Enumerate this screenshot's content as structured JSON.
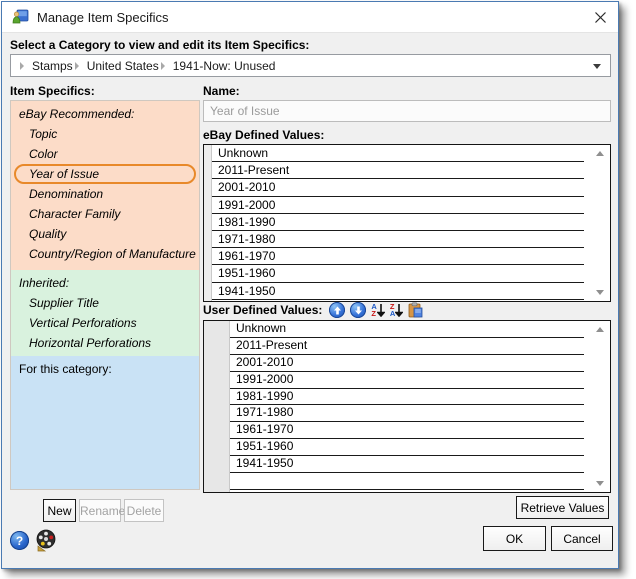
{
  "window": {
    "title": "Manage Item Specifics"
  },
  "category_section": {
    "label": "Select a Category to view and edit its Item Specifics:",
    "breadcrumb": [
      "Stamps",
      "United States",
      "1941-Now: Unused"
    ]
  },
  "item_specifics": {
    "label": "Item Specifics:",
    "recommended": {
      "header": "eBay Recommended:",
      "items": [
        {
          "label": "Topic"
        },
        {
          "label": "Color"
        },
        {
          "label": "Year of Issue",
          "selected": true
        },
        {
          "label": "Denomination"
        },
        {
          "label": "Character Family"
        },
        {
          "label": "Quality"
        },
        {
          "label": "Country/Region of Manufacture"
        }
      ]
    },
    "inherited": {
      "header": "Inherited:",
      "items": [
        {
          "label": "Supplier Title"
        },
        {
          "label": "Vertical Perforations"
        },
        {
          "label": "Horizontal Perforations"
        }
      ]
    },
    "category": {
      "header": "For this category:",
      "items": []
    }
  },
  "name_field": {
    "label": "Name:",
    "value": "Year of Issue"
  },
  "ebay_values": {
    "label": "eBay Defined Values:",
    "items": [
      "Unknown",
      "2011-Present",
      "2001-2010",
      "1991-2000",
      "1981-1990",
      "1971-1980",
      "1961-1970",
      "1951-1960",
      "1941-1950"
    ]
  },
  "user_values": {
    "label": "User Defined Values:",
    "toolbar_icons": [
      "move-up",
      "move-down",
      "sort-ascending",
      "sort-descending",
      "paste"
    ],
    "items": [
      "Unknown",
      "2011-Present",
      "2001-2010",
      "1991-2000",
      "1981-1990",
      "1971-1980",
      "1961-1970",
      "1951-1960",
      "1941-1950"
    ]
  },
  "buttons": {
    "new": "New",
    "rename": "Rename",
    "delete": "Delete",
    "retrieve": "Retrieve Values",
    "ok": "OK",
    "cancel": "Cancel"
  },
  "help": {
    "question_mark": "?"
  },
  "colors": {
    "window_border": "#4a7ab2",
    "recommended_bg": "#fcdcc8",
    "inherited_bg": "#d9f2de",
    "category_bg": "#c9e2f5",
    "selected_outline": "#e8892a"
  }
}
